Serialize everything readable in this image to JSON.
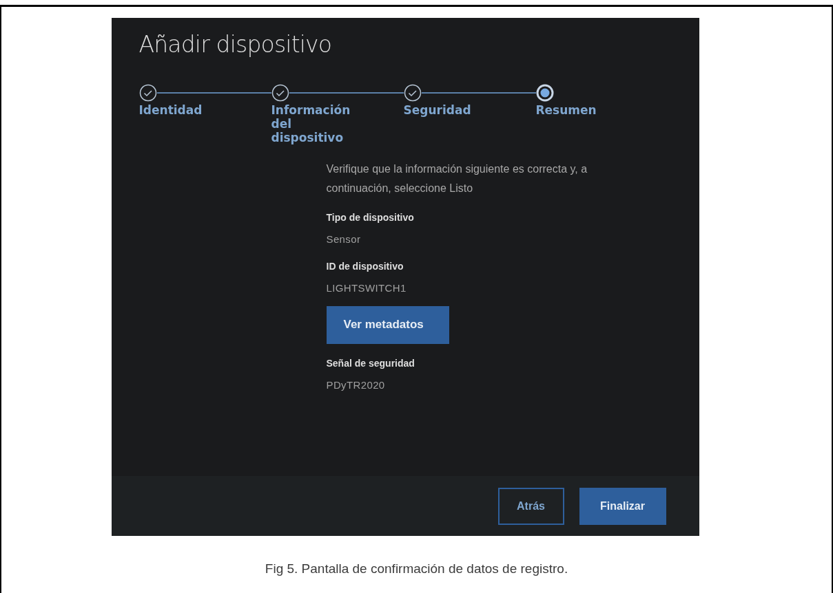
{
  "dialog": {
    "title": "Añadir dispositivo",
    "steps": [
      {
        "label": "Identidad",
        "completed": true
      },
      {
        "label": "Información del dispositivo",
        "completed": true
      },
      {
        "label": "Seguridad",
        "completed": true
      },
      {
        "label": "Resumen",
        "completed": false
      }
    ],
    "intro": "Verifique que la información siguiente es correcta y, a continuación, seleccione Listo",
    "fields": [
      {
        "label": "Tipo de dispositivo",
        "value": "Sensor"
      },
      {
        "label": "ID de dispositivo",
        "value": "LIGHTSWITCH1"
      },
      {
        "kind": "button",
        "label": "Ver metadatos"
      },
      {
        "label": "Señal de seguridad",
        "value": "PDyTR2020"
      }
    ],
    "buttons": [
      {
        "label": "Atrás",
        "kind": "secondary"
      },
      {
        "label": "Finalizar",
        "kind": "primary"
      }
    ]
  },
  "caption": "Fig 5. Pantalla de confirmación de datos de registro."
}
